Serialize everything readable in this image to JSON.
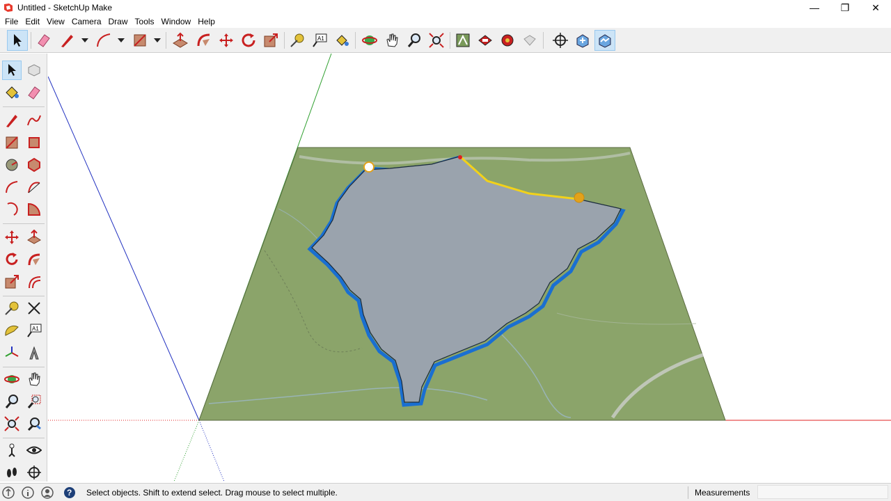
{
  "window": {
    "title": "Untitled - SketchUp Make",
    "minimize_glyph": "—",
    "restore_glyph": "❐",
    "close_glyph": "✕"
  },
  "menu": [
    "File",
    "Edit",
    "View",
    "Camera",
    "Draw",
    "Tools",
    "Window",
    "Help"
  ],
  "toolbar_icons": [
    "select-icon",
    "eraser-icon",
    "pencil-line-icon",
    "arc-icon",
    "rectangle-icon",
    "push-pull-icon",
    "follow-me-icon",
    "move-icon",
    "rotate-icon",
    "scale-icon",
    "tape-measure-icon",
    "text-icon",
    "paint-bucket-icon",
    "orbit-icon",
    "pan-icon",
    "zoom-icon",
    "zoom-extents-icon",
    "3d-warehouse-icon",
    "extension-warehouse-icon",
    "layout-icon",
    "send-to-layout-icon",
    "position-camera-icon",
    "add-location-icon",
    "toggle-terrain-icon"
  ],
  "left_toolbar_icons": [
    "select-icon",
    "component-icon",
    "paint-bucket-icon",
    "eraser-icon",
    "line-icon",
    "freehand-icon",
    "rectangle-icon",
    "rotated-rectangle-icon",
    "circle-icon",
    "polygon-icon",
    "arc-icon",
    "two-point-arc-icon",
    "three-point-arc-icon",
    "pie-icon",
    "move-icon",
    "push-pull-icon",
    "rotate-icon",
    "follow-me-icon",
    "scale-icon",
    "offset-icon",
    "tape-measure-icon",
    "dimension-icon",
    "protractor-icon",
    "text-icon",
    "axes-icon",
    "3d-text-icon",
    "orbit-icon",
    "pan-icon",
    "zoom-icon",
    "zoom-window-icon",
    "zoom-extents-icon",
    "previous-view-icon",
    "position-camera-icon",
    "look-around-icon",
    "walk-icon",
    "section-plane-icon"
  ],
  "status": {
    "message": "Select objects. Shift to extend select. Drag mouse to select multiple.",
    "measurements_label": "Measurements",
    "measurements_value": ""
  },
  "colors": {
    "terrain_green": "#8ba46a",
    "lake_gray": "#9aa3ad",
    "lake_outline": "#1a6fd1",
    "axis_red": "#e02020",
    "axis_green": "#30a030",
    "axis_blue": "#2030c0",
    "toolbar_bg": "#f0f0f0"
  }
}
